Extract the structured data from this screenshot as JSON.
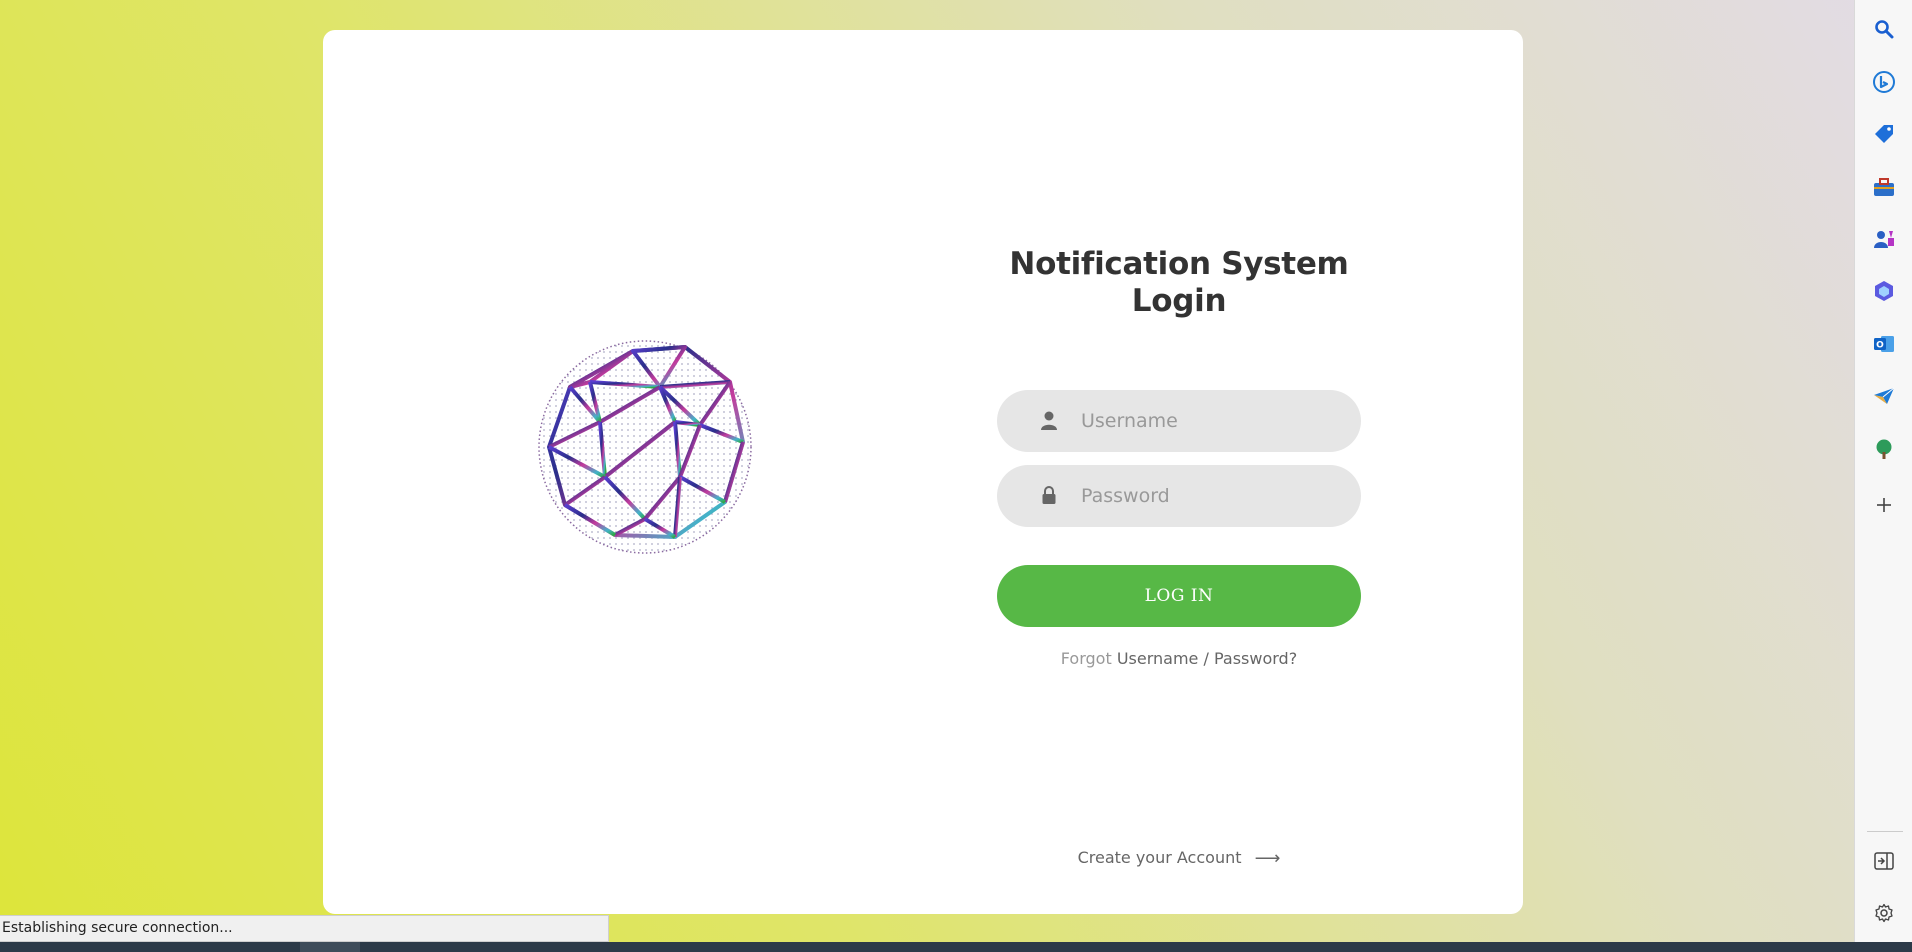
{
  "login": {
    "title": "Notification System Login",
    "username_placeholder": "Username",
    "password_placeholder": "Password",
    "login_button": "LOG IN",
    "forgot_prefix": "Forgot",
    "forgot_link": "Username / Password?",
    "create_account": "Create your Account",
    "accent_color": "#57b846"
  },
  "sidebar": {
    "items": [
      {
        "icon": "search-icon"
      },
      {
        "icon": "bing-chat-icon"
      },
      {
        "icon": "shopping-tag-icon"
      },
      {
        "icon": "tools-briefcase-icon"
      },
      {
        "icon": "games-icon"
      },
      {
        "icon": "office-icon"
      },
      {
        "icon": "outlook-icon"
      },
      {
        "icon": "send-icon"
      },
      {
        "icon": "tree-icon"
      },
      {
        "icon": "add-icon"
      },
      {
        "icon": "sidebar-layout-icon"
      },
      {
        "icon": "settings-gear-icon"
      }
    ]
  },
  "status_bar": {
    "text": "Establishing secure connection..."
  }
}
